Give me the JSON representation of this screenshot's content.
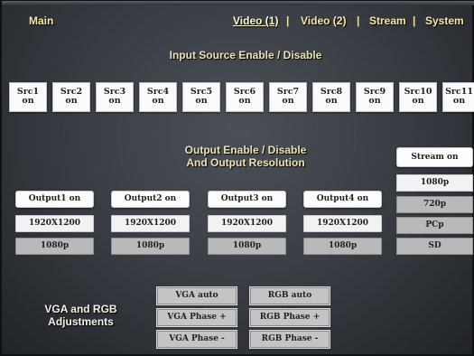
{
  "nav": {
    "main": "Main",
    "video1": "Video (1)",
    "video2": "Video (2)",
    "stream": "Stream",
    "system": "System",
    "separator": "|"
  },
  "input_section": {
    "title": "Input Source Enable / Disable",
    "sources": [
      {
        "name": "Src1",
        "state": "on"
      },
      {
        "name": "Src2",
        "state": "on"
      },
      {
        "name": "Src3",
        "state": "on"
      },
      {
        "name": "Src4",
        "state": "on"
      },
      {
        "name": "Src5",
        "state": "on"
      },
      {
        "name": "Src6",
        "state": "on"
      },
      {
        "name": "Src7",
        "state": "on"
      },
      {
        "name": "Src8",
        "state": "on"
      },
      {
        "name": "Src9",
        "state": "on"
      },
      {
        "name": "Src10",
        "state": "on"
      },
      {
        "name": "Src11",
        "state": "on"
      }
    ]
  },
  "output_section": {
    "title_line1": "Output Enable / Disable",
    "title_line2": "And Output Resolution",
    "outputs": [
      {
        "toggle": "Output1 on",
        "resolution": "1920X1200",
        "mode": "1080p"
      },
      {
        "toggle": "Output2 on",
        "resolution": "1920X1200",
        "mode": "1080p"
      },
      {
        "toggle": "Output3 on",
        "resolution": "1920X1200",
        "mode": "1080p"
      },
      {
        "toggle": "Output4 on",
        "resolution": "1920X1200",
        "mode": "1080p"
      }
    ],
    "stream": {
      "toggle": "Stream on",
      "options": [
        "1080p",
        "720p",
        "PCp",
        "SD"
      ],
      "selected": "1080p"
    }
  },
  "vga_section": {
    "label_line1": "VGA and RGB",
    "label_line2": "Adjustments",
    "vga_auto": "VGA auto position",
    "vga_phase_plus": "VGA Phase +",
    "vga_phase_minus": "VGA Phase -",
    "rgb_auto": "RGB auto position",
    "rgb_phase_plus": "RGB Phase +",
    "rgb_phase_minus": "RGB Phase -"
  }
}
